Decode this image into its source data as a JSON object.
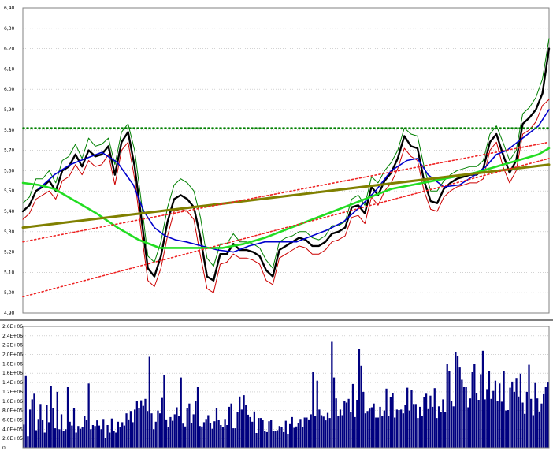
{
  "chart_data": [
    {
      "type": "line",
      "title": "",
      "xlabel": "",
      "ylabel": "",
      "ylim": [
        4.9,
        6.4
      ],
      "yticks": [
        "4,90",
        "5,00",
        "5,10",
        "5,20",
        "5,30",
        "5,40",
        "5,50",
        "5,60",
        "5,70",
        "5,80",
        "5,90",
        "6,00",
        "6,10",
        "6,20",
        "6,30",
        "6,40"
      ],
      "grid": true,
      "legend": "none",
      "n_points": 250,
      "series": [
        {
          "role": "price-high-envelope",
          "color": "#008000",
          "values": [
            5.44,
            5.47,
            5.56,
            5.56,
            5.6,
            5.54,
            5.65,
            5.67,
            5.73,
            5.66,
            5.76,
            5.72,
            5.73,
            5.76,
            5.63,
            5.79,
            5.83,
            5.7,
            5.45,
            5.18,
            5.15,
            5.25,
            5.42,
            5.53,
            5.56,
            5.54,
            5.5,
            5.37,
            5.17,
            5.13,
            5.24,
            5.24,
            5.29,
            5.25,
            5.25,
            5.24,
            5.22,
            5.16,
            5.12,
            5.25,
            5.27,
            5.28,
            5.3,
            5.3,
            5.27,
            5.26,
            5.28,
            5.33,
            5.33,
            5.35,
            5.46,
            5.48,
            5.43,
            5.57,
            5.54,
            5.6,
            5.64,
            5.7,
            5.81,
            5.78,
            5.77,
            5.62,
            5.5,
            5.5,
            5.55,
            5.58,
            5.6,
            5.61,
            5.62,
            5.62,
            5.65,
            5.78,
            5.82,
            5.74,
            5.65,
            5.7,
            5.88,
            5.91,
            5.96,
            6.05,
            6.25
          ]
        },
        {
          "role": "price-close",
          "color": "#000000",
          "values": [
            5.4,
            5.43,
            5.5,
            5.52,
            5.55,
            5.5,
            5.6,
            5.62,
            5.68,
            5.62,
            5.7,
            5.67,
            5.68,
            5.72,
            5.58,
            5.74,
            5.79,
            5.62,
            5.37,
            5.12,
            5.08,
            5.18,
            5.35,
            5.46,
            5.48,
            5.46,
            5.42,
            5.27,
            5.08,
            5.06,
            5.19,
            5.19,
            5.24,
            5.21,
            5.21,
            5.2,
            5.18,
            5.11,
            5.08,
            5.21,
            5.23,
            5.25,
            5.27,
            5.26,
            5.23,
            5.23,
            5.25,
            5.29,
            5.3,
            5.32,
            5.42,
            5.43,
            5.39,
            5.52,
            5.48,
            5.55,
            5.59,
            5.66,
            5.77,
            5.72,
            5.71,
            5.55,
            5.45,
            5.44,
            5.51,
            5.54,
            5.56,
            5.57,
            5.58,
            5.58,
            5.61,
            5.74,
            5.78,
            5.68,
            5.59,
            5.65,
            5.83,
            5.86,
            5.9,
            5.98,
            6.2
          ]
        },
        {
          "role": "price-low-envelope",
          "color": "#cc0000",
          "values": [
            5.36,
            5.39,
            5.46,
            5.48,
            5.5,
            5.46,
            5.55,
            5.57,
            5.63,
            5.58,
            5.65,
            5.62,
            5.63,
            5.68,
            5.53,
            5.7,
            5.74,
            5.56,
            5.3,
            5.06,
            5.03,
            5.12,
            5.28,
            5.4,
            5.41,
            5.4,
            5.36,
            5.18,
            5.02,
            5.0,
            5.14,
            5.15,
            5.19,
            5.17,
            5.17,
            5.16,
            5.14,
            5.06,
            5.04,
            5.17,
            5.19,
            5.21,
            5.23,
            5.22,
            5.19,
            5.19,
            5.21,
            5.25,
            5.26,
            5.28,
            5.37,
            5.38,
            5.34,
            5.47,
            5.43,
            5.5,
            5.54,
            5.61,
            5.71,
            5.67,
            5.65,
            5.5,
            5.41,
            5.4,
            5.47,
            5.5,
            5.52,
            5.53,
            5.54,
            5.54,
            5.56,
            5.7,
            5.74,
            5.62,
            5.54,
            5.6,
            5.78,
            5.8,
            5.84,
            5.92,
            5.95
          ]
        },
        {
          "role": "moving-average-short",
          "color": "#0000cc",
          "x": [
            0.03,
            0.06,
            0.09,
            0.12,
            0.15,
            0.18,
            0.21,
            0.23,
            0.25,
            0.27,
            0.29,
            0.31,
            0.34,
            0.37,
            0.4,
            0.43,
            0.46,
            0.49,
            0.52,
            0.55,
            0.58,
            0.61,
            0.64,
            0.67,
            0.7,
            0.73,
            0.75,
            0.77,
            0.8,
            0.83,
            0.86,
            0.88,
            0.9,
            0.92,
            0.94,
            0.96,
            0.98,
            1.0
          ],
          "values": [
            5.51,
            5.58,
            5.63,
            5.66,
            5.69,
            5.64,
            5.53,
            5.4,
            5.32,
            5.28,
            5.26,
            5.25,
            5.23,
            5.21,
            5.2,
            5.23,
            5.25,
            5.25,
            5.25,
            5.28,
            5.31,
            5.35,
            5.42,
            5.5,
            5.6,
            5.65,
            5.66,
            5.58,
            5.52,
            5.53,
            5.58,
            5.62,
            5.68,
            5.7,
            5.74,
            5.78,
            5.82,
            5.9
          ]
        },
        {
          "role": "moving-average-long",
          "color": "#22dd22",
          "x": [
            0.0,
            0.03,
            0.06,
            0.1,
            0.14,
            0.18,
            0.22,
            0.26,
            0.3,
            0.34,
            0.38,
            0.42,
            0.46,
            0.5,
            0.54,
            0.58,
            0.62,
            0.66,
            0.7,
            0.74,
            0.78,
            0.82,
            0.86,
            0.9,
            0.94,
            0.98,
            1.0
          ],
          "values": [
            5.54,
            5.53,
            5.51,
            5.45,
            5.39,
            5.32,
            5.26,
            5.22,
            5.22,
            5.22,
            5.22,
            5.24,
            5.27,
            5.31,
            5.35,
            5.39,
            5.43,
            5.47,
            5.51,
            5.53,
            5.55,
            5.57,
            5.59,
            5.62,
            5.65,
            5.68,
            5.71
          ]
        },
        {
          "role": "trendline",
          "color": "#808000",
          "x": [
            0.0,
            1.0
          ],
          "values": [
            5.32,
            5.63
          ]
        },
        {
          "role": "trendline",
          "color": "#ee2222",
          "dashed": true,
          "x": [
            0.0,
            1.0
          ],
          "values": [
            4.98,
            5.66
          ]
        },
        {
          "role": "trendline",
          "color": "#ee2222",
          "dashed": true,
          "x": [
            0.0,
            1.0
          ],
          "values": [
            5.25,
            5.74
          ]
        },
        {
          "role": "trendline",
          "color": "#008000",
          "dashed": true,
          "x": [
            0.0,
            1.0
          ],
          "values": [
            5.81,
            5.81
          ]
        }
      ]
    },
    {
      "type": "bar",
      "title": "",
      "xlabel": "",
      "ylabel": "",
      "ylim": [
        0,
        2600000
      ],
      "yticks": [
        "0",
        "2,0E+05",
        "4,0E+05",
        "6,0E+05",
        "8,0E+05",
        "1,0E+06",
        "1,2E+06",
        "1,4E+06",
        "1,6E+06",
        "1,8E+06",
        "2,0E+06",
        "2,2E+06",
        "2,4E+06",
        "2,6E+06"
      ],
      "grid": true,
      "legend": "none",
      "color": "#000080",
      "values": [
        500000,
        1540000,
        250000,
        820000,
        1040000,
        1160000,
        380000,
        620000,
        940000,
        600000,
        330000,
        920000,
        550000,
        1320000,
        860000,
        420000,
        1200000,
        400000,
        720000,
        370000,
        400000,
        1300000,
        560000,
        480000,
        860000,
        330000,
        470000,
        410000,
        440000,
        690000,
        600000,
        1380000,
        400000,
        490000,
        470000,
        590000,
        480000,
        400000,
        620000,
        220000,
        490000,
        330000,
        630000,
        360000,
        330000,
        560000,
        440000,
        550000,
        480000,
        740000,
        610000,
        790000,
        550000,
        820000,
        1010000,
        850000,
        1020000,
        900000,
        1050000,
        790000,
        1950000,
        740000,
        400000,
        560000,
        800000,
        740000,
        1070000,
        1560000,
        610000,
        450000,
        660000,
        580000,
        720000,
        870000,
        690000,
        1510000,
        520000,
        460000,
        860000,
        950000,
        540000,
        720000,
        1000000,
        1300000,
        470000,
        460000,
        550000,
        620000,
        700000,
        530000,
        410000,
        570000,
        850000,
        600000,
        490000,
        440000,
        620000,
        490000,
        880000,
        950000,
        420000,
        420000,
        770000,
        1100000,
        820000,
        1130000,
        920000,
        710000,
        660000,
        560000,
        780000,
        320000,
        640000,
        640000,
        600000,
        370000,
        340000,
        570000,
        600000,
        360000,
        370000,
        380000,
        470000,
        440000,
        340000,
        580000,
        300000,
        510000,
        660000,
        430000,
        460000,
        530000,
        620000,
        450000,
        650000,
        650000,
        610000,
        720000,
        1620000,
        680000,
        1440000,
        820000,
        700000,
        670000,
        590000,
        750000,
        640000,
        2270000,
        1510000,
        1060000,
        680000,
        820000,
        700000,
        1010000,
        970000,
        1050000,
        760000,
        1370000,
        660000,
        1030000,
        2120000,
        1760000,
        1200000,
        740000,
        790000,
        840000,
        870000,
        950000,
        650000,
        650000,
        880000,
        690000,
        800000,
        1270000,
        690000,
        1080000,
        1180000,
        650000,
        820000,
        810000,
        820000,
        740000,
        920000,
        1290000,
        800000,
        1240000,
        940000,
        940000,
        640000,
        880000,
        690000,
        1080000,
        1160000,
        830000,
        1120000,
        880000,
        1280000,
        640000,
        890000,
        760000,
        1040000,
        760000,
        1800000,
        1640000,
        1010000,
        890000,
        2060000,
        1960000,
        1720000,
        1460000,
        1300000,
        1300000,
        870000,
        1060000,
        1620000,
        1790000,
        1170000,
        1030000,
        1580000,
        2080000,
        1040000,
        1260000,
        1650000,
        1050000,
        1220000,
        1440000,
        1000000,
        1380000,
        990000,
        1640000,
        800000,
        810000,
        1290000,
        1420000,
        1200000,
        1500000,
        1100000,
        1590000,
        970000,
        730000,
        1200000,
        1780000,
        1050000,
        700000,
        1390000,
        1060000,
        780000,
        950000,
        1150000,
        1300000,
        1400000
      ]
    }
  ]
}
